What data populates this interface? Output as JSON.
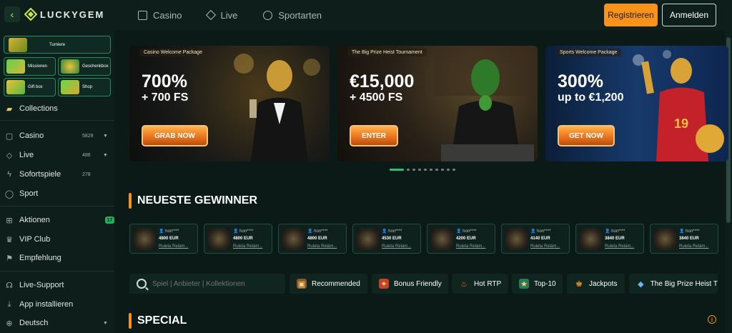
{
  "header": {
    "logo_text": "LUCKYGEM",
    "nav": [
      {
        "label": "Casino",
        "icon": "casino-icon"
      },
      {
        "label": "Live",
        "icon": "live-icon"
      },
      {
        "label": "Sportarten",
        "icon": "sport-icon"
      }
    ],
    "register_label": "Registrieren",
    "login_label": "Anmelden",
    "colors": {
      "accent": "#f7931a",
      "brand_green": "#2bbf74"
    }
  },
  "sidebar": {
    "promo_tiles": [
      "Turniere",
      "Missionen",
      "Geschenkbox",
      "Gift box",
      "Shop"
    ],
    "collections": "Collections",
    "items": [
      {
        "label": "Casino",
        "count": "5829"
      },
      {
        "label": "Live",
        "count": "486"
      },
      {
        "label": "Sofortspiele",
        "count": "278"
      },
      {
        "label": "Sport"
      }
    ],
    "aktionen": {
      "label": "Aktionen",
      "badge": "17"
    },
    "vip": "VIP Club",
    "empfehlung": "Empfehlung",
    "support": "Live-Support",
    "install": "App installieren",
    "language": "Deutsch"
  },
  "banners": [
    {
      "tag": "Casino Welcome Package",
      "big": "700%",
      "sub": "+ 700 FS",
      "button": "GRAB NOW"
    },
    {
      "tag": "The Big Prize Heist Tournament",
      "big": "€15,000",
      "sub": "+ 4500 FS",
      "button": "ENTER"
    },
    {
      "tag": "Sports Welcome Package",
      "big": "300%",
      "sub": "up to €1,200",
      "button": "GET NOW"
    }
  ],
  "carousel": {
    "pages": 10,
    "active": 1
  },
  "winners_title": "NEUESTE GEWINNER",
  "winners": [
    {
      "user": "hon****",
      "amount": "4800 EUR",
      "game": "Ruleta Relám..."
    },
    {
      "user": "hon****",
      "amount": "4800 EUR",
      "game": "Ruleta Relám..."
    },
    {
      "user": "hon****",
      "amount": "4800 EUR",
      "game": "Ruleta Relám..."
    },
    {
      "user": "hon****",
      "amount": "4530 EUR",
      "game": "Ruleta Relám..."
    },
    {
      "user": "hon****",
      "amount": "4200 EUR",
      "game": "Ruleta Relám..."
    },
    {
      "user": "hon****",
      "amount": "4140 EUR",
      "game": "Ruleta Relám..."
    },
    {
      "user": "hon****",
      "amount": "3840 EUR",
      "game": "Ruleta Relám..."
    },
    {
      "user": "hon****",
      "amount": "3840 EUR",
      "game": "Ruleta Relám..."
    }
  ],
  "search": {
    "placeholder": "Spiel | Anbieter | Kollektionen"
  },
  "filters": [
    {
      "label": "Recommended",
      "icon": "recommended-icon"
    },
    {
      "label": "Bonus Friendly",
      "icon": "bonus-icon"
    },
    {
      "label": "Hot RTP",
      "icon": "fire-icon"
    },
    {
      "label": "Top-10",
      "icon": "top10-icon"
    },
    {
      "label": "Jackpots",
      "icon": "jackpot-icon"
    },
    {
      "label": "The Big Prize Heist T",
      "icon": "diamond-icon"
    }
  ],
  "special_title": "SPECIAL"
}
